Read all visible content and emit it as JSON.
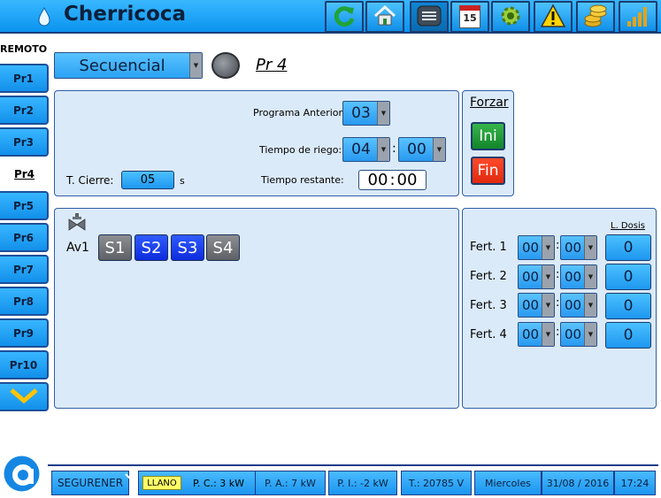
{
  "header": {
    "title": "Cherricoca",
    "icons": [
      "refresh-icon",
      "home-icon",
      "menu-list-icon",
      "calendar-icon",
      "gear-icon",
      "warning-icon",
      "coins-icon",
      "signal-bars-icon"
    ],
    "calendar_day": "15"
  },
  "sidebar": {
    "heading": "REMOTO",
    "items": [
      "Pr1",
      "Pr2",
      "Pr3",
      "Pr4",
      "Pr5",
      "Pr6",
      "Pr7",
      "Pr8",
      "Pr9",
      "Pr10"
    ],
    "selected": "Pr4"
  },
  "program": {
    "mode": "Secuencial",
    "name": "Pr 4"
  },
  "settings": {
    "prev_label": "Programa Anterior:",
    "prev_value": "03",
    "riego_label": "Tiempo de riego:",
    "riego_hours": "04",
    "riego_minutes": "00",
    "colon": ":",
    "restante_label": "Tiempo restante:",
    "restante_h": "00",
    "restante_m": "00",
    "cierre_label": "T. Cierre:",
    "cierre_value": "05",
    "cierre_unit": "s"
  },
  "forzar": {
    "title": "Forzar",
    "ini": "Ini",
    "fin": "Fin"
  },
  "valves": {
    "row_label": "Av1",
    "sectors": [
      {
        "label": "S1",
        "state": "off"
      },
      {
        "label": "S2",
        "state": "on"
      },
      {
        "label": "S3",
        "state": "on"
      },
      {
        "label": "S4",
        "state": "off"
      }
    ]
  },
  "fert": {
    "dose_header": "L. Dosis",
    "rows": [
      {
        "label": "Fert. 1",
        "h": "00",
        "m": "00",
        "dose": "0"
      },
      {
        "label": "Fert. 2",
        "h": "00",
        "m": "00",
        "dose": "0"
      },
      {
        "label": "Fert. 3",
        "h": "00",
        "m": "00",
        "dose": "0"
      },
      {
        "label": "Fert. 4",
        "h": "00",
        "m": "00",
        "dose": "0"
      }
    ]
  },
  "footer": {
    "company": "SEGURENER",
    "tariff": "LLANO",
    "pc": "P. C.: 3 kW",
    "pa": "P. A.: 7 kW",
    "pi": "P. I.: -2 kW",
    "voltage": "T.: 20785 V",
    "weekday": "Miercoles",
    "date": "31/08 / 2016",
    "time": "17:24"
  },
  "colors": {
    "accent": "#1290ea",
    "panel": "#dbeaf9",
    "sector_on": "#1a3bf0",
    "sector_off": "#6f7276",
    "ini": "#1c8f33",
    "fin": "#f03a1c"
  }
}
